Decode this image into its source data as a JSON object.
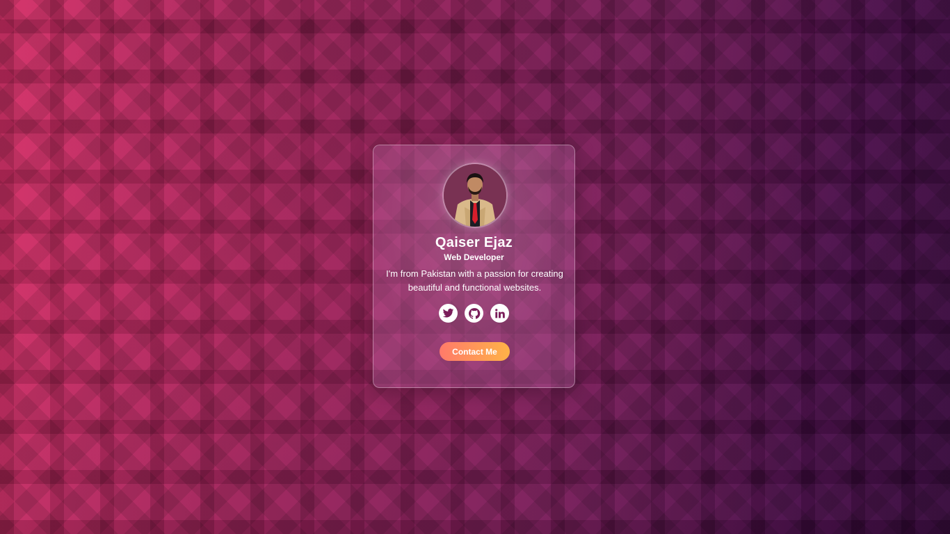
{
  "profile": {
    "name": "Qaiser Ejaz",
    "role": "Web Developer",
    "bio": "I'm from Pakistan with a passion for creating beautiful and functional websites."
  },
  "socials": [
    {
      "icon": "twitter-icon"
    },
    {
      "icon": "github-icon"
    },
    {
      "icon": "linkedin-icon"
    }
  ],
  "contact": {
    "label": "Contact Me"
  },
  "colors": {
    "background_start": "#d42e66",
    "background_end": "#35083a",
    "button_start": "#ff7a6a",
    "button_end": "#ffb347",
    "icon_color": "#7a1d5a"
  }
}
